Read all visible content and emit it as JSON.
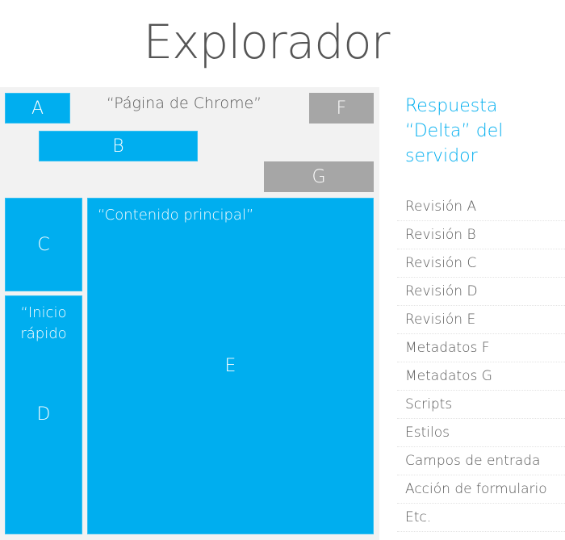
{
  "title": "Explorador",
  "browser_diagram": {
    "page_label": "“Página de Chrome”",
    "boxes": {
      "A": "A",
      "B": "B",
      "C": "C",
      "D": "D",
      "E": "E",
      "F": "F",
      "G": "G"
    },
    "main_content_label": "“Contenido principal”",
    "quick_start_label": "“Inicio rápido"
  },
  "server_response": {
    "heading": "Respuesta “Delta” del servidor",
    "items": [
      "Revisión A",
      "Revisión B",
      "Revisión C",
      "Revisión D",
      "Revisión E",
      "Metadatos F",
      "Metadatos G",
      "Scripts",
      "Estilos",
      "Campos de entrada",
      "Acción de formulario",
      "Etc."
    ]
  },
  "colors": {
    "accent_blue": "#00aeef",
    "neutral_gray": "#a6a6a6",
    "panel_bg": "#f2f2f2",
    "text_gray": "#595959"
  }
}
